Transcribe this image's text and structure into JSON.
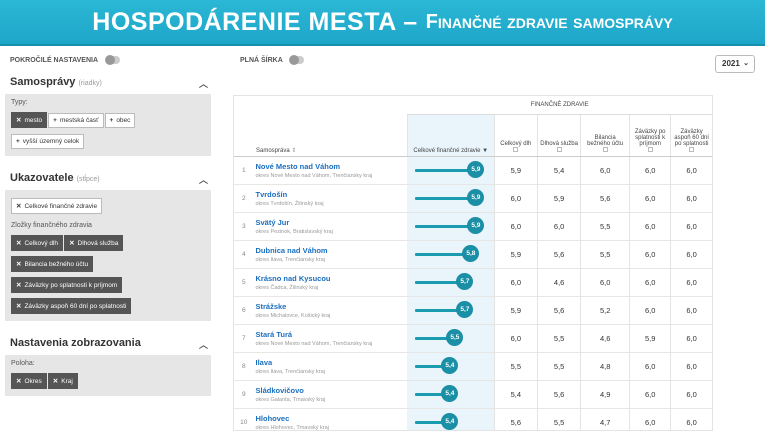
{
  "banner": {
    "title_main": "HOSPODÁRENIE MESTA –",
    "title_sub": "Finančné zdravie samosprávy"
  },
  "topbar": {
    "advanced": "POKROČILÉ NASTAVENIA",
    "fullwidth": "PLNÁ ŠÍRKA",
    "year": "2021"
  },
  "sidebar": {
    "s1": {
      "title": "Samosprávy",
      "hint": "(riadky)",
      "types_label": "Typy:",
      "chips": [
        {
          "label": "mesto",
          "active": true
        },
        {
          "label": "mestská časť",
          "active": false
        },
        {
          "label": "obec",
          "active": false
        },
        {
          "label": "vyšší územný celok",
          "active": false
        }
      ]
    },
    "s2": {
      "title": "Ukazovatele",
      "hint": "(stĺpce)",
      "main_chip": "Celkové finančné zdravie",
      "sub_label": "Zložky finančného zdravia",
      "chips": [
        "Celkový dlh",
        "Dlhová služba",
        "Bilancia bežného účtu",
        "Záväzky po splatnosti k príjmom",
        "Záväzky aspoň 60 dní po splatnosti"
      ]
    },
    "s3": {
      "title": "Nastavenia zobrazovania",
      "pos_label": "Poloha:",
      "chips": [
        "Okres",
        "Kraj"
      ]
    }
  },
  "table": {
    "group_header": "FINANČNÉ ZDRAVIE",
    "headers": {
      "name": "Samospráva",
      "score": "Celkové finančné zdravie",
      "debt": "Celkový dlh",
      "service": "Dlhová služba",
      "balance": "Bilancia bežného účtu",
      "overdue": "Záväzky po splatnosti k príjmom",
      "overdue60": "Záväzky aspoň 60 dní po splatnosti"
    },
    "rows": [
      {
        "idx": "1",
        "name": "Nové Mesto nad Váhom",
        "sub": "okres Nové Mesto nad Váhom, Trenčiansky kraj",
        "score": "5,9",
        "score_val": 5.9,
        "debt": "5,9",
        "service": "5,4",
        "balance": "6,0",
        "overdue": "6,0",
        "overdue60": "6,0"
      },
      {
        "idx": "2",
        "name": "Tvrdošín",
        "sub": "okres Tvrdošín, Žilinský kraj",
        "score": "5,9",
        "score_val": 5.9,
        "debt": "6,0",
        "service": "5,9",
        "balance": "5,6",
        "overdue": "6,0",
        "overdue60": "6,0"
      },
      {
        "idx": "3",
        "name": "Svätý Jur",
        "sub": "okres Pezinok, Bratislavský kraj",
        "score": "5,9",
        "score_val": 5.9,
        "debt": "6,0",
        "service": "6,0",
        "balance": "5,5",
        "overdue": "6,0",
        "overdue60": "6,0"
      },
      {
        "idx": "4",
        "name": "Dubnica nad Váhom",
        "sub": "okres Ilava, Trenčiansky kraj",
        "score": "5,8",
        "score_val": 5.8,
        "debt": "5,9",
        "service": "5,6",
        "balance": "5,5",
        "overdue": "6,0",
        "overdue60": "6,0"
      },
      {
        "idx": "5",
        "name": "Krásno nad Kysucou",
        "sub": "okres Čadca, Žilinský kraj",
        "score": "5,7",
        "score_val": 5.7,
        "debt": "6,0",
        "service": "4,6",
        "balance": "6,0",
        "overdue": "6,0",
        "overdue60": "6,0"
      },
      {
        "idx": "6",
        "name": "Strážske",
        "sub": "okres Michalovce, Košický kraj",
        "score": "5,7",
        "score_val": 5.7,
        "debt": "5,9",
        "service": "5,6",
        "balance": "5,2",
        "overdue": "6,0",
        "overdue60": "6,0"
      },
      {
        "idx": "7",
        "name": "Stará Turá",
        "sub": "okres Nové Mesto nad Váhom, Trenčiansky kraj",
        "score": "5,5",
        "score_val": 5.5,
        "debt": "6,0",
        "service": "5,5",
        "balance": "4,6",
        "overdue": "5,9",
        "overdue60": "6,0"
      },
      {
        "idx": "8",
        "name": "Ilava",
        "sub": "okres Ilava, Trenčiansky kraj",
        "score": "5,4",
        "score_val": 5.4,
        "debt": "5,5",
        "service": "5,5",
        "balance": "4,8",
        "overdue": "6,0",
        "overdue60": "6,0"
      },
      {
        "idx": "9",
        "name": "Sládkovičovo",
        "sub": "okres Galanta, Trnavský kraj",
        "score": "5,4",
        "score_val": 5.4,
        "debt": "5,4",
        "service": "5,6",
        "balance": "4,9",
        "overdue": "6,0",
        "overdue60": "6,0"
      },
      {
        "idx": "10",
        "name": "Hlohovec",
        "sub": "okres Hlohovec, Trnavský kraj",
        "score": "5,4",
        "score_val": 5.4,
        "debt": "5,6",
        "service": "5,5",
        "balance": "4,7",
        "overdue": "6,0",
        "overdue60": "6,0"
      }
    ]
  }
}
